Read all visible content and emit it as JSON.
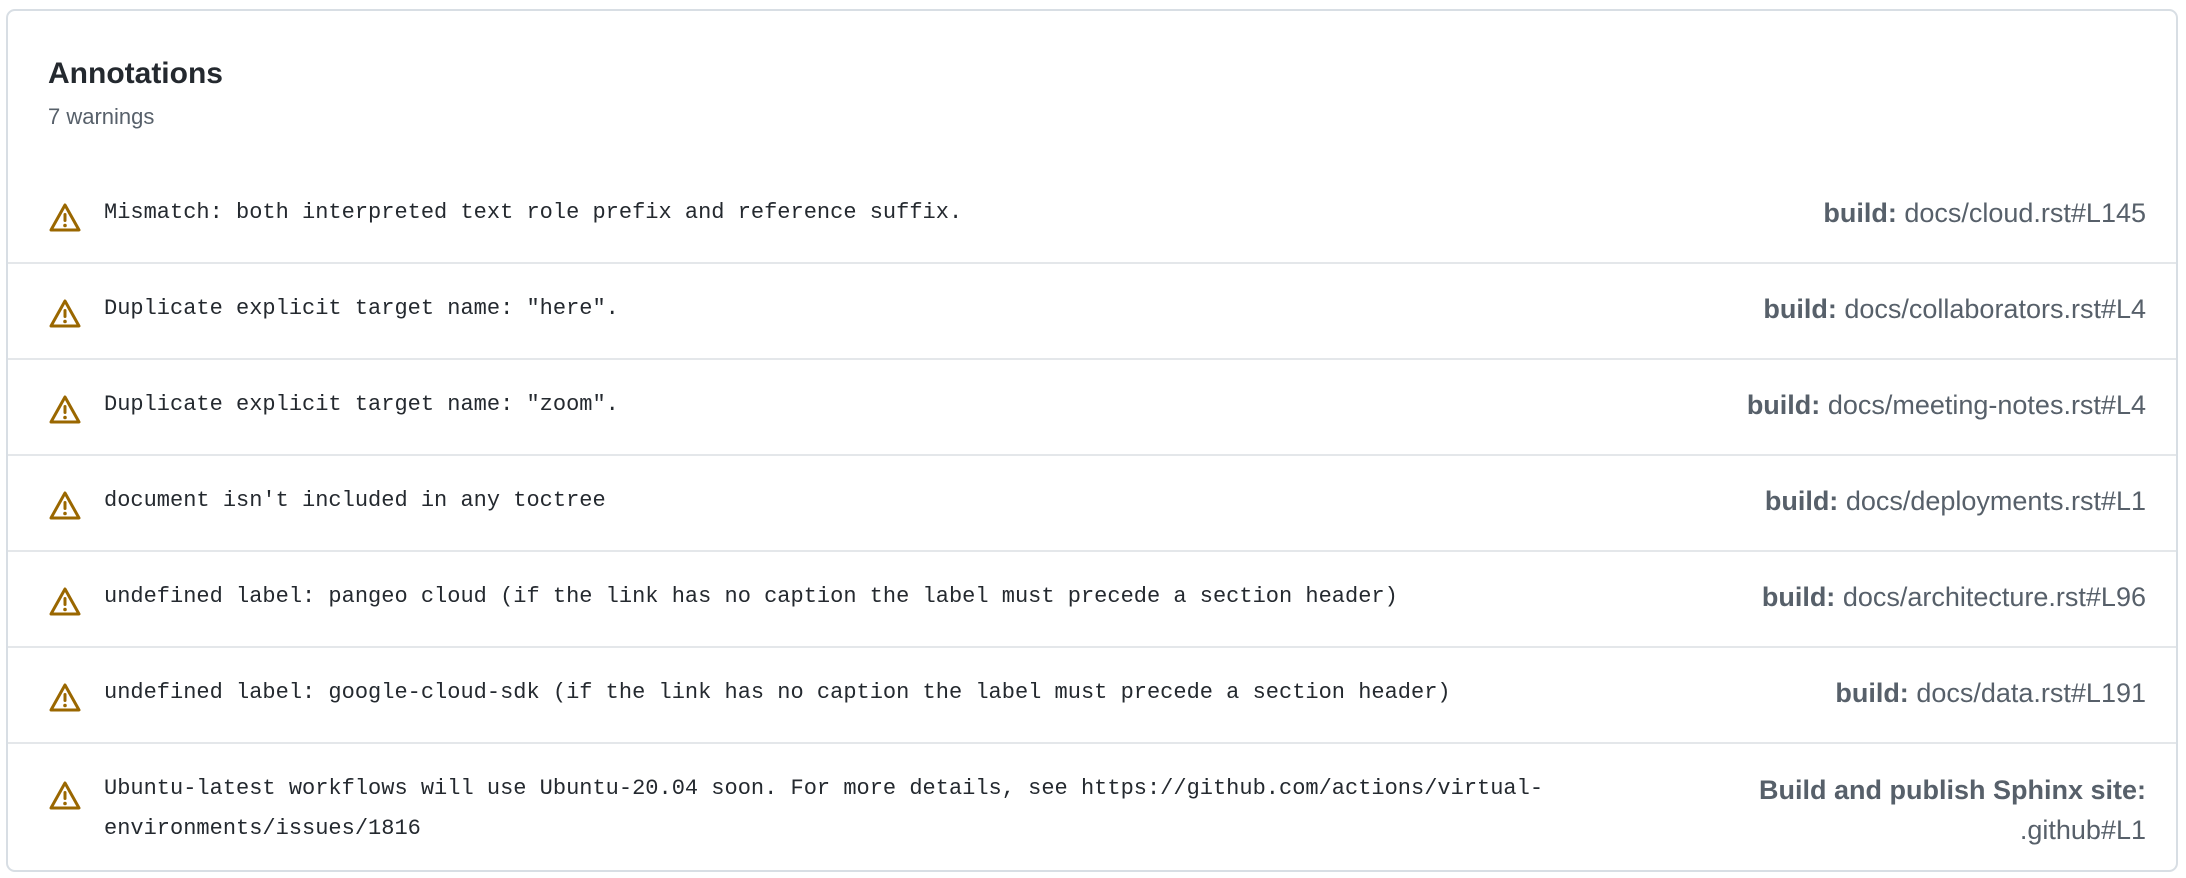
{
  "annotations": {
    "title": "Annotations",
    "summary": "7 warnings",
    "colors": {
      "warning_icon": "#9a6700",
      "border": "#d8dee4",
      "muted_text": "#57606a"
    },
    "items": [
      {
        "icon": "alert-triangle-icon",
        "message": "Mismatch: both interpreted text role prefix and reference suffix.",
        "job": "build:",
        "location": "docs/cloud.rst#L145"
      },
      {
        "icon": "alert-triangle-icon",
        "message": "Duplicate explicit target name: \"here\".",
        "job": "build:",
        "location": "docs/collaborators.rst#L4"
      },
      {
        "icon": "alert-triangle-icon",
        "message": "Duplicate explicit target name: \"zoom\".",
        "job": "build:",
        "location": "docs/meeting-notes.rst#L4"
      },
      {
        "icon": "alert-triangle-icon",
        "message": "document isn't included in any toctree",
        "job": "build:",
        "location": "docs/deployments.rst#L1"
      },
      {
        "icon": "alert-triangle-icon",
        "message": "undefined label: pangeo cloud (if the link has no caption the label must precede a section header)",
        "job": "build:",
        "location": "docs/architecture.rst#L96"
      },
      {
        "icon": "alert-triangle-icon",
        "message": "undefined label: google-cloud-sdk (if the link has no caption the label must precede a section header)",
        "job": "build:",
        "location": "docs/data.rst#L191"
      },
      {
        "icon": "alert-triangle-icon",
        "message": "Ubuntu-latest workflows will use Ubuntu-20.04 soon. For more details, see https://github.com/actions/virtual-environments/issues/1816",
        "job": "Build and publish Sphinx site:",
        "location": ".github#L1"
      }
    ]
  }
}
